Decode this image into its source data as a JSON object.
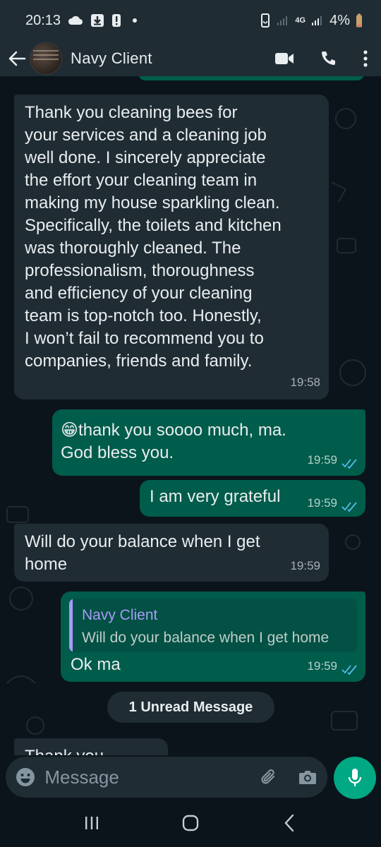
{
  "status_bar": {
    "time": "20:13",
    "network": "4G",
    "battery": "4%"
  },
  "header": {
    "contact_name": "Navy Client"
  },
  "messages": [
    {
      "direction": "incoming",
      "text": "Thank you cleaning bees for your services and a cleaning job well done. I sincerely appreciate the effort your cleaning team in making my house sparkling clean. Specifically, the toilets and kitchen was thoroughly cleaned. The professionalism, thoroughness and efficiency of your cleaning team is top-notch too. Honestly, I won’t fail to recommend you to companies, friends and family.",
      "lines": [
        "Thank you cleaning bees for",
        "your services and a cleaning job",
        "well done. I sincerely appreciate",
        "the effort your cleaning team in",
        "making my house sparkling clean.",
        "Specifically, the toilets and kitchen",
        "was thoroughly cleaned. The",
        "professionalism, thoroughness",
        "and efficiency of your cleaning",
        "team is top-notch too. Honestly,",
        "I won’t fail to recommend you to",
        "companies, friends and family."
      ],
      "time": "19:58"
    },
    {
      "direction": "outgoing",
      "lines": [
        "😁thank you soooo much, ma.",
        "God bless you."
      ],
      "time": "19:59",
      "status": "read"
    },
    {
      "direction": "outgoing",
      "lines": [
        "I am very grateful"
      ],
      "time": "19:59",
      "status": "read"
    },
    {
      "direction": "incoming",
      "lines": [
        "Will do your balance when I get",
        "home"
      ],
      "time": "19:59"
    },
    {
      "direction": "outgoing",
      "quote": {
        "author": "Navy Client",
        "text": "Will do your balance when I get home"
      },
      "lines": [
        "Ok ma"
      ],
      "time": "19:59",
      "status": "read"
    }
  ],
  "unread_banner": "1 Unread Message",
  "partial_message": "Thank you",
  "composer": {
    "placeholder": "Message"
  },
  "colors": {
    "background": "#0b141a",
    "bar": "#1f2c34",
    "incoming_bubble": "#1f2c34",
    "outgoing_bubble": "#005c4b",
    "read_ticks": "#53bdeb",
    "accent": "#00a884",
    "quote_name": "#a99af8"
  },
  "icons": {
    "status": [
      "cloud-icon",
      "download-icon",
      "alert-icon",
      "recycle-icon",
      "signal-icon",
      "battery-icon"
    ],
    "header": [
      "back-arrow-icon",
      "video-call-icon",
      "phone-icon",
      "more-vert-icon"
    ],
    "composer": [
      "emoji-icon",
      "attach-icon",
      "camera-icon",
      "mic-icon"
    ],
    "nav": [
      "recents-icon",
      "home-icon",
      "back-icon"
    ]
  }
}
